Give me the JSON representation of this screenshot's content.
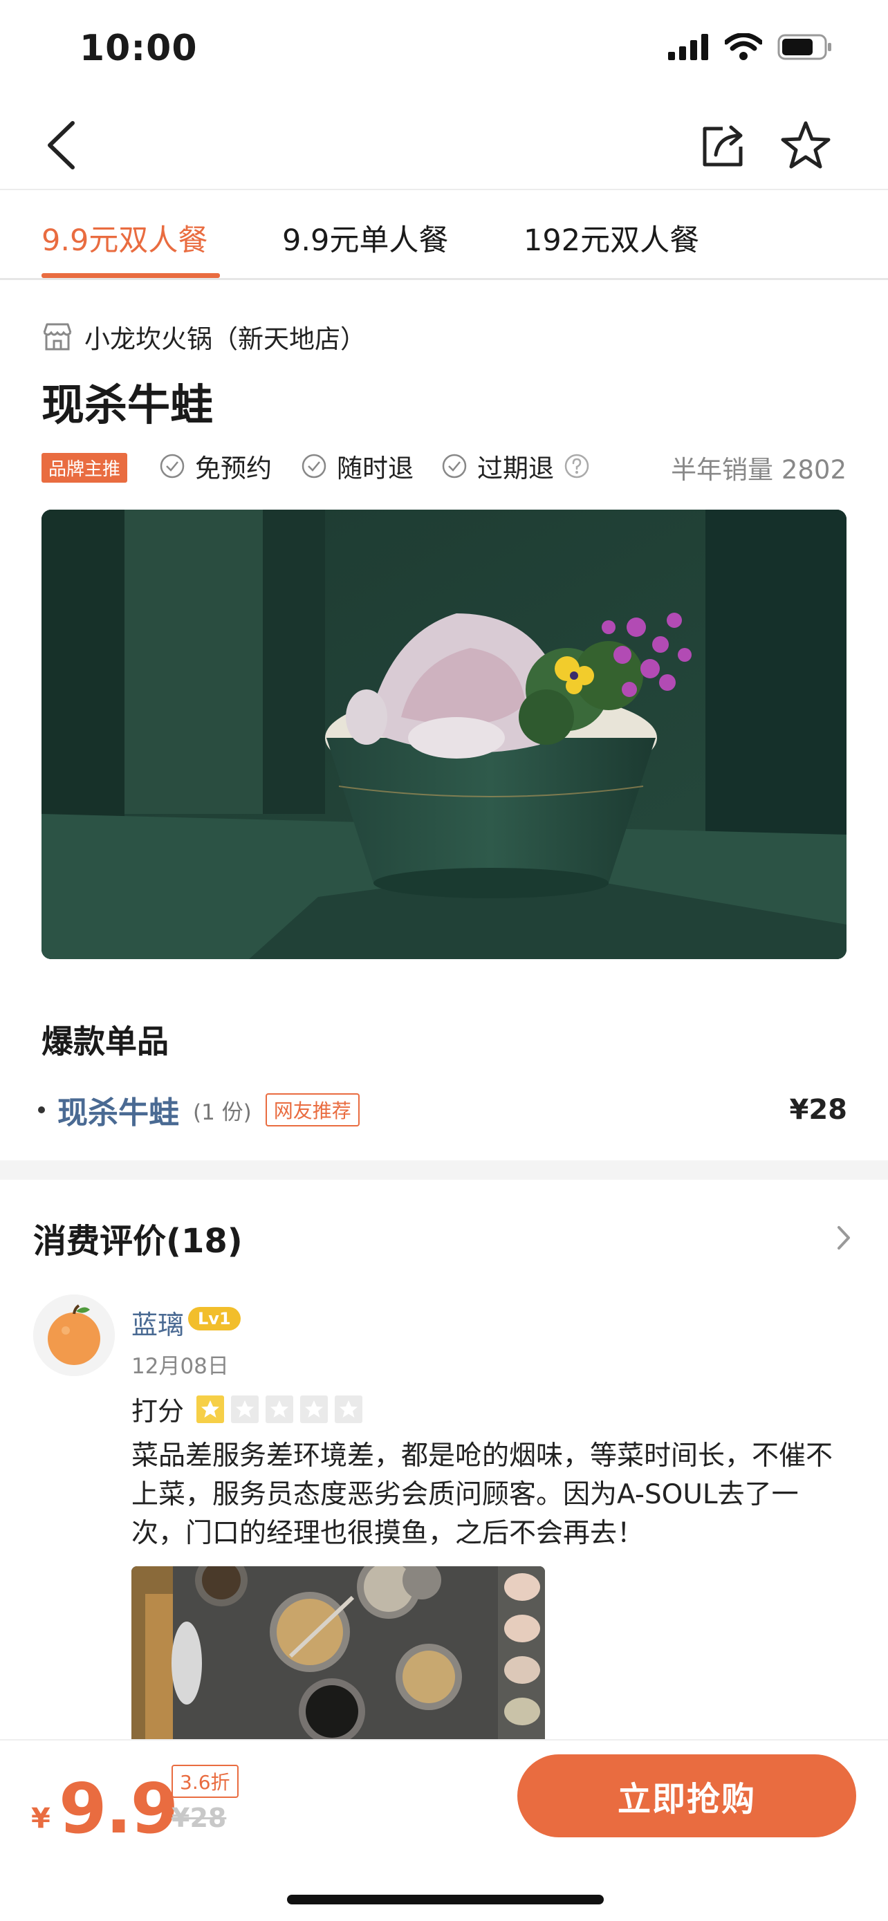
{
  "status_bar": {
    "time": "10:00"
  },
  "tabs": [
    {
      "label": "9.9元双人餐"
    },
    {
      "label": "9.9元单人餐"
    },
    {
      "label": "192元双人餐"
    }
  ],
  "shop": {
    "name": "小龙坎火锅（新天地店）"
  },
  "deal": {
    "title": "现杀牛蛙",
    "brand_badge": "品牌主推",
    "tags": [
      "免预约",
      "随时退",
      "过期退"
    ],
    "sales": "半年销量 2802"
  },
  "section": {
    "title": "爆款单品",
    "item": {
      "name": "现杀牛蛙",
      "qty": "(1 份)",
      "badge": "网友推荐",
      "price": "¥28"
    }
  },
  "reviews": {
    "header": "消费评价(18)",
    "item": {
      "name": "蓝璃",
      "level": "Lv1",
      "date": "12月08日",
      "score_label": "打分",
      "stars": 1,
      "text": "菜品差服务差环境差，都是呛的烟味，等菜时间长，不催不上菜，服务员态度恶劣会质问顾客。因为A-SOUL去了一次，门口的经理也很摸鱼，之后不会再去！"
    }
  },
  "purchase": {
    "yen": "¥",
    "price": "9.9",
    "discount": "3.6折",
    "original": "¥28",
    "button": "立即抢购"
  },
  "colors": {
    "accent": "#e96c40",
    "link": "#4a6a93",
    "gold": "#f2be2b"
  },
  "icons": [
    "back-icon",
    "share-icon",
    "star-icon",
    "store-icon",
    "check-circle-icon",
    "help-icon",
    "chevron-right-icon"
  ]
}
